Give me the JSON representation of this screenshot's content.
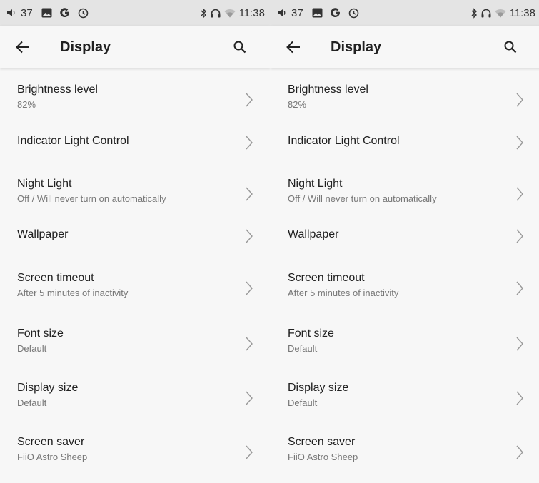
{
  "status_bar": {
    "volume_level": "37",
    "time": "11:38",
    "icons": [
      "volume-icon",
      "gallery-icon",
      "google-g-icon",
      "sync-icon",
      "bluetooth-icon",
      "headphones-icon",
      "wifi-icon"
    ]
  },
  "app_bar": {
    "title": "Display",
    "back_icon": "arrow-left-icon",
    "search_icon": "search-icon"
  },
  "items": [
    {
      "title": "Brightness level",
      "summary": "82%"
    },
    {
      "title": "Indicator Light Control",
      "summary": ""
    },
    {
      "title": "Night Light",
      "summary": "Off / Will never turn on automatically"
    },
    {
      "title": "Wallpaper",
      "summary": ""
    },
    {
      "title": "Screen timeout",
      "summary": "After 5 minutes of inactivity"
    },
    {
      "title": "Font size",
      "summary": "Default"
    },
    {
      "title": "Display size",
      "summary": "Default"
    },
    {
      "title": "Screen saver",
      "summary": "FiiO Astro Sheep"
    }
  ],
  "colors": {
    "status_bar_bg": "#e4e4e4",
    "background": "#f7f7f7",
    "text_primary": "#212121",
    "text_secondary": "#777777"
  }
}
